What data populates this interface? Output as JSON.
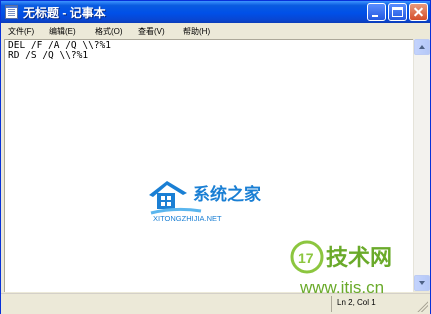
{
  "window": {
    "title": "无标题 - 记事本"
  },
  "menubar": {
    "items": [
      {
        "label": "文件(F)"
      },
      {
        "label": "编辑(E)"
      },
      {
        "label": "格式(O)"
      },
      {
        "label": "查看(V)"
      },
      {
        "label": "帮助(H)"
      }
    ]
  },
  "editor": {
    "lines": [
      "DEL /F /A /Q \\\\?%1",
      "RD /S /Q \\\\?%1"
    ]
  },
  "statusbar": {
    "position": "Ln 2, Col 1"
  },
  "watermarks": {
    "center_logo": {
      "name": "系统之家",
      "url": "XITONGZHIJIA.NET"
    },
    "corner_logo": {
      "badge": "17",
      "name": "技术网",
      "url": "www.itjs.cn"
    }
  },
  "colors": {
    "titlebar": "#0050e8",
    "logo_blue": "#1a7fd4",
    "logo_green": "#6aaa2a"
  }
}
